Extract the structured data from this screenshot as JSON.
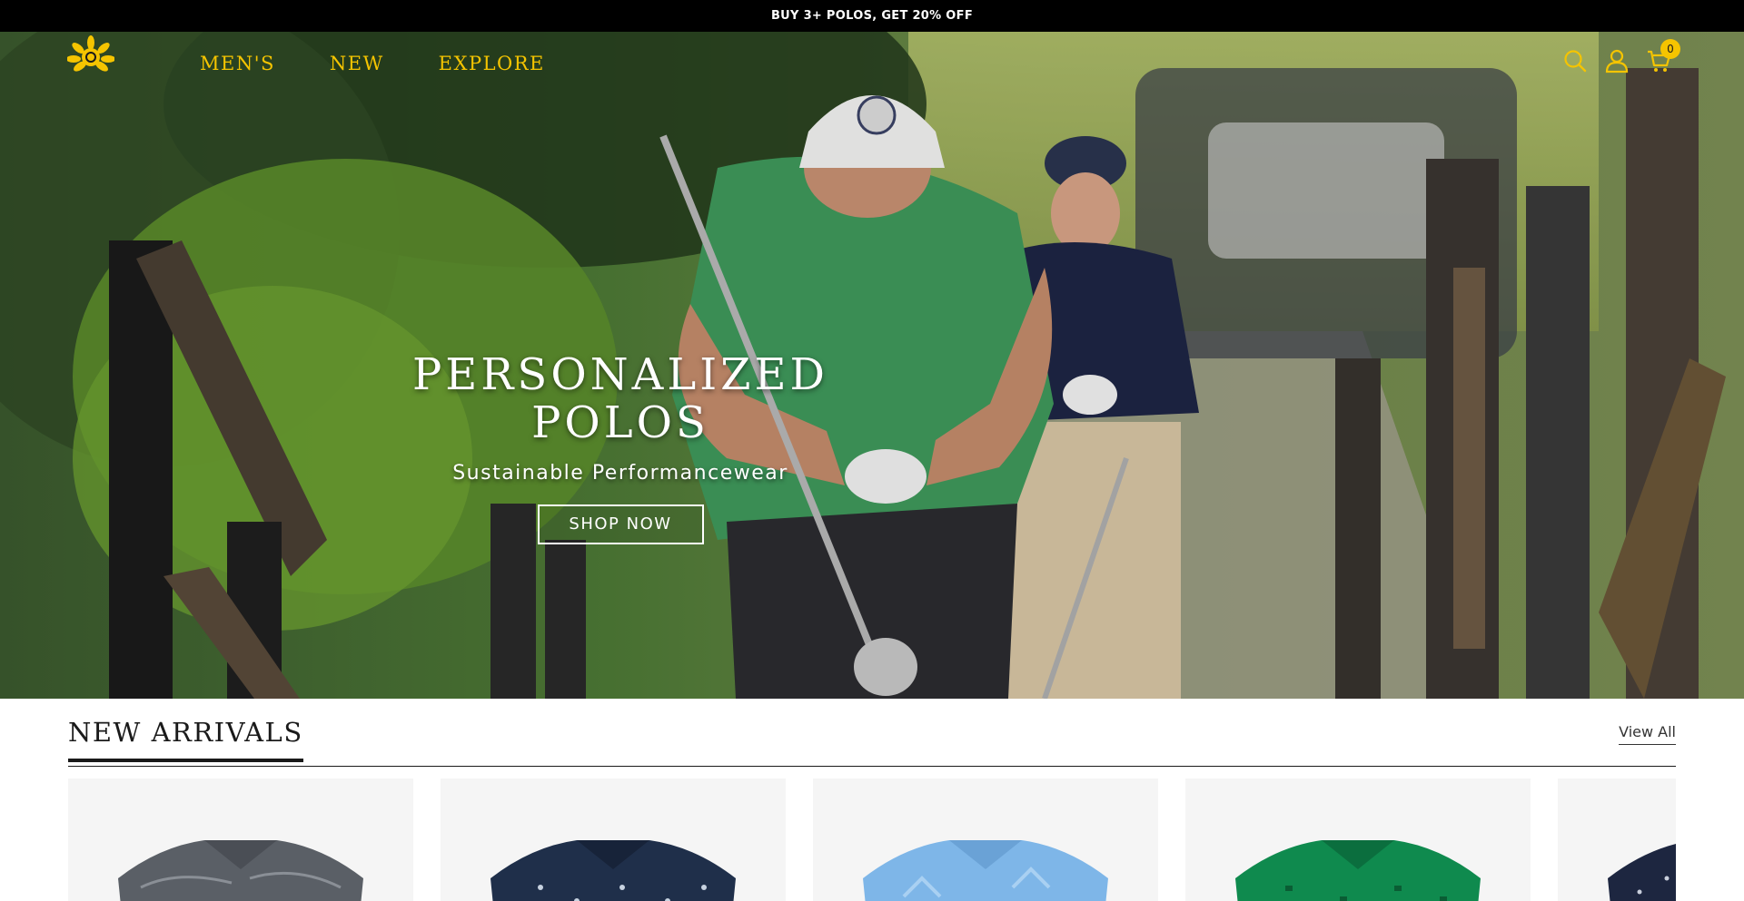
{
  "announcement": {
    "text": "BUY 3+ POLOS, GET 20% OFF"
  },
  "header": {
    "logo_icon": "sun-flower-logo-icon",
    "nav": [
      {
        "label": "MEN'S"
      },
      {
        "label": "NEW"
      },
      {
        "label": "EXPLORE"
      }
    ],
    "icons": [
      "search-icon",
      "account-icon",
      "cart-icon"
    ],
    "cart_count": "0",
    "accent_color": "#f5c400"
  },
  "hero": {
    "title_line1": "PERSONALIZED",
    "title_line2": "POLOS",
    "subtitle": "Sustainable Performancewear",
    "cta_label": "SHOP NOW"
  },
  "new_arrivals": {
    "title": "NEW ARRIVALS",
    "view_all_label": "View All",
    "products": [
      {
        "color": "#5a5f66"
      },
      {
        "color": "#1f2f4a"
      },
      {
        "color": "#7eb6e8"
      },
      {
        "color": "#0f8a4e"
      },
      {
        "color": "#1d2640"
      }
    ]
  }
}
